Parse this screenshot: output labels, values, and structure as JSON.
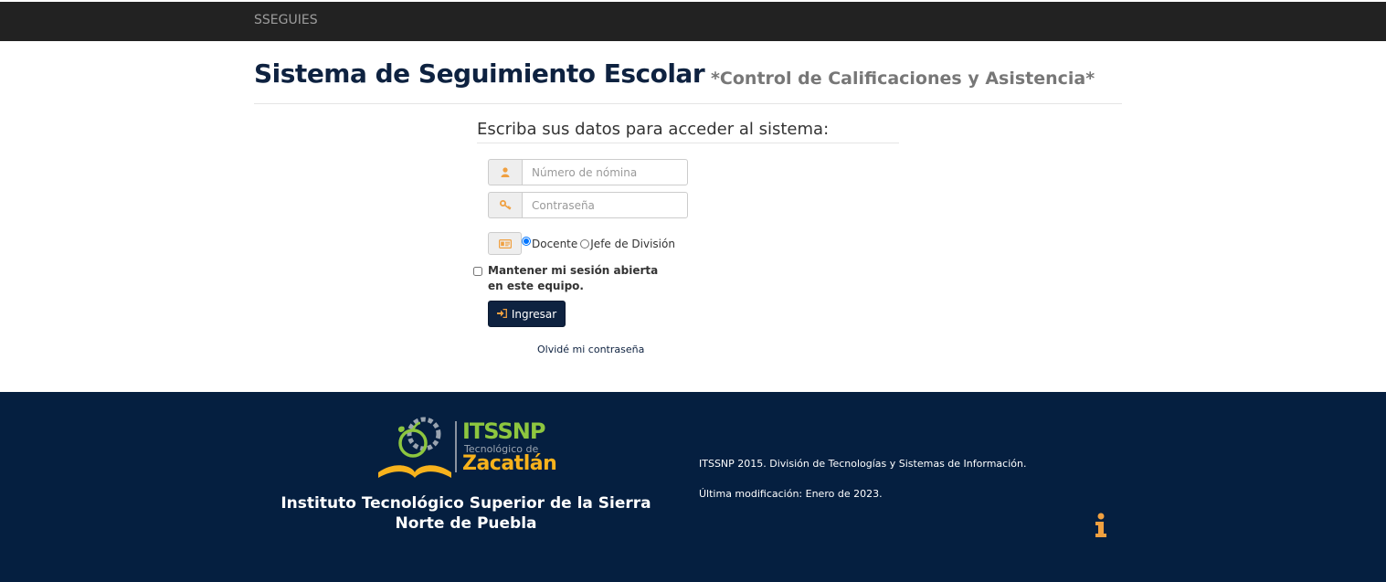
{
  "navbar": {
    "brand": "SSEGUIES"
  },
  "header": {
    "title": "Sistema de Seguimiento Escolar",
    "subtitle": "*Control de Calificaciones y Asistencia*"
  },
  "form": {
    "heading": "Escriba sus datos para acceder al sistema:",
    "username_placeholder": "Número de nómina",
    "password_placeholder": "Contraseña",
    "role_options": [
      "Docente",
      "Jefe de División"
    ],
    "selected_role": "Docente",
    "remember_label": "Mantener mi sesión abierta en este equipo.",
    "remember_checked": false,
    "submit_label": "Ingresar",
    "forgot_link": "Olvidé mi contraseña"
  },
  "footer": {
    "logo": {
      "main": "ITSSNP",
      "sub": "Tecnológico de",
      "city": "Zacatlán"
    },
    "institution": "Instituto Tecnológico Superior de la Sierra Norte de Puebla",
    "copyright": "ITSSNP 2015. División de Tecnologías y Sistemas de Información.",
    "last_modified": "Última modificación: Enero de 2023."
  },
  "icons": {
    "user": "user-icon",
    "key": "key-icon",
    "id_card": "id-card-icon",
    "login": "sign-in-icon",
    "info": "info-icon"
  },
  "colors": {
    "navbar_bg": "#222222",
    "primary": "#0e2240",
    "footer_bg": "#051f40",
    "accent_orange": "#f0a040",
    "logo_green": "#8dc63f",
    "logo_yellow": "#f7b21c"
  }
}
